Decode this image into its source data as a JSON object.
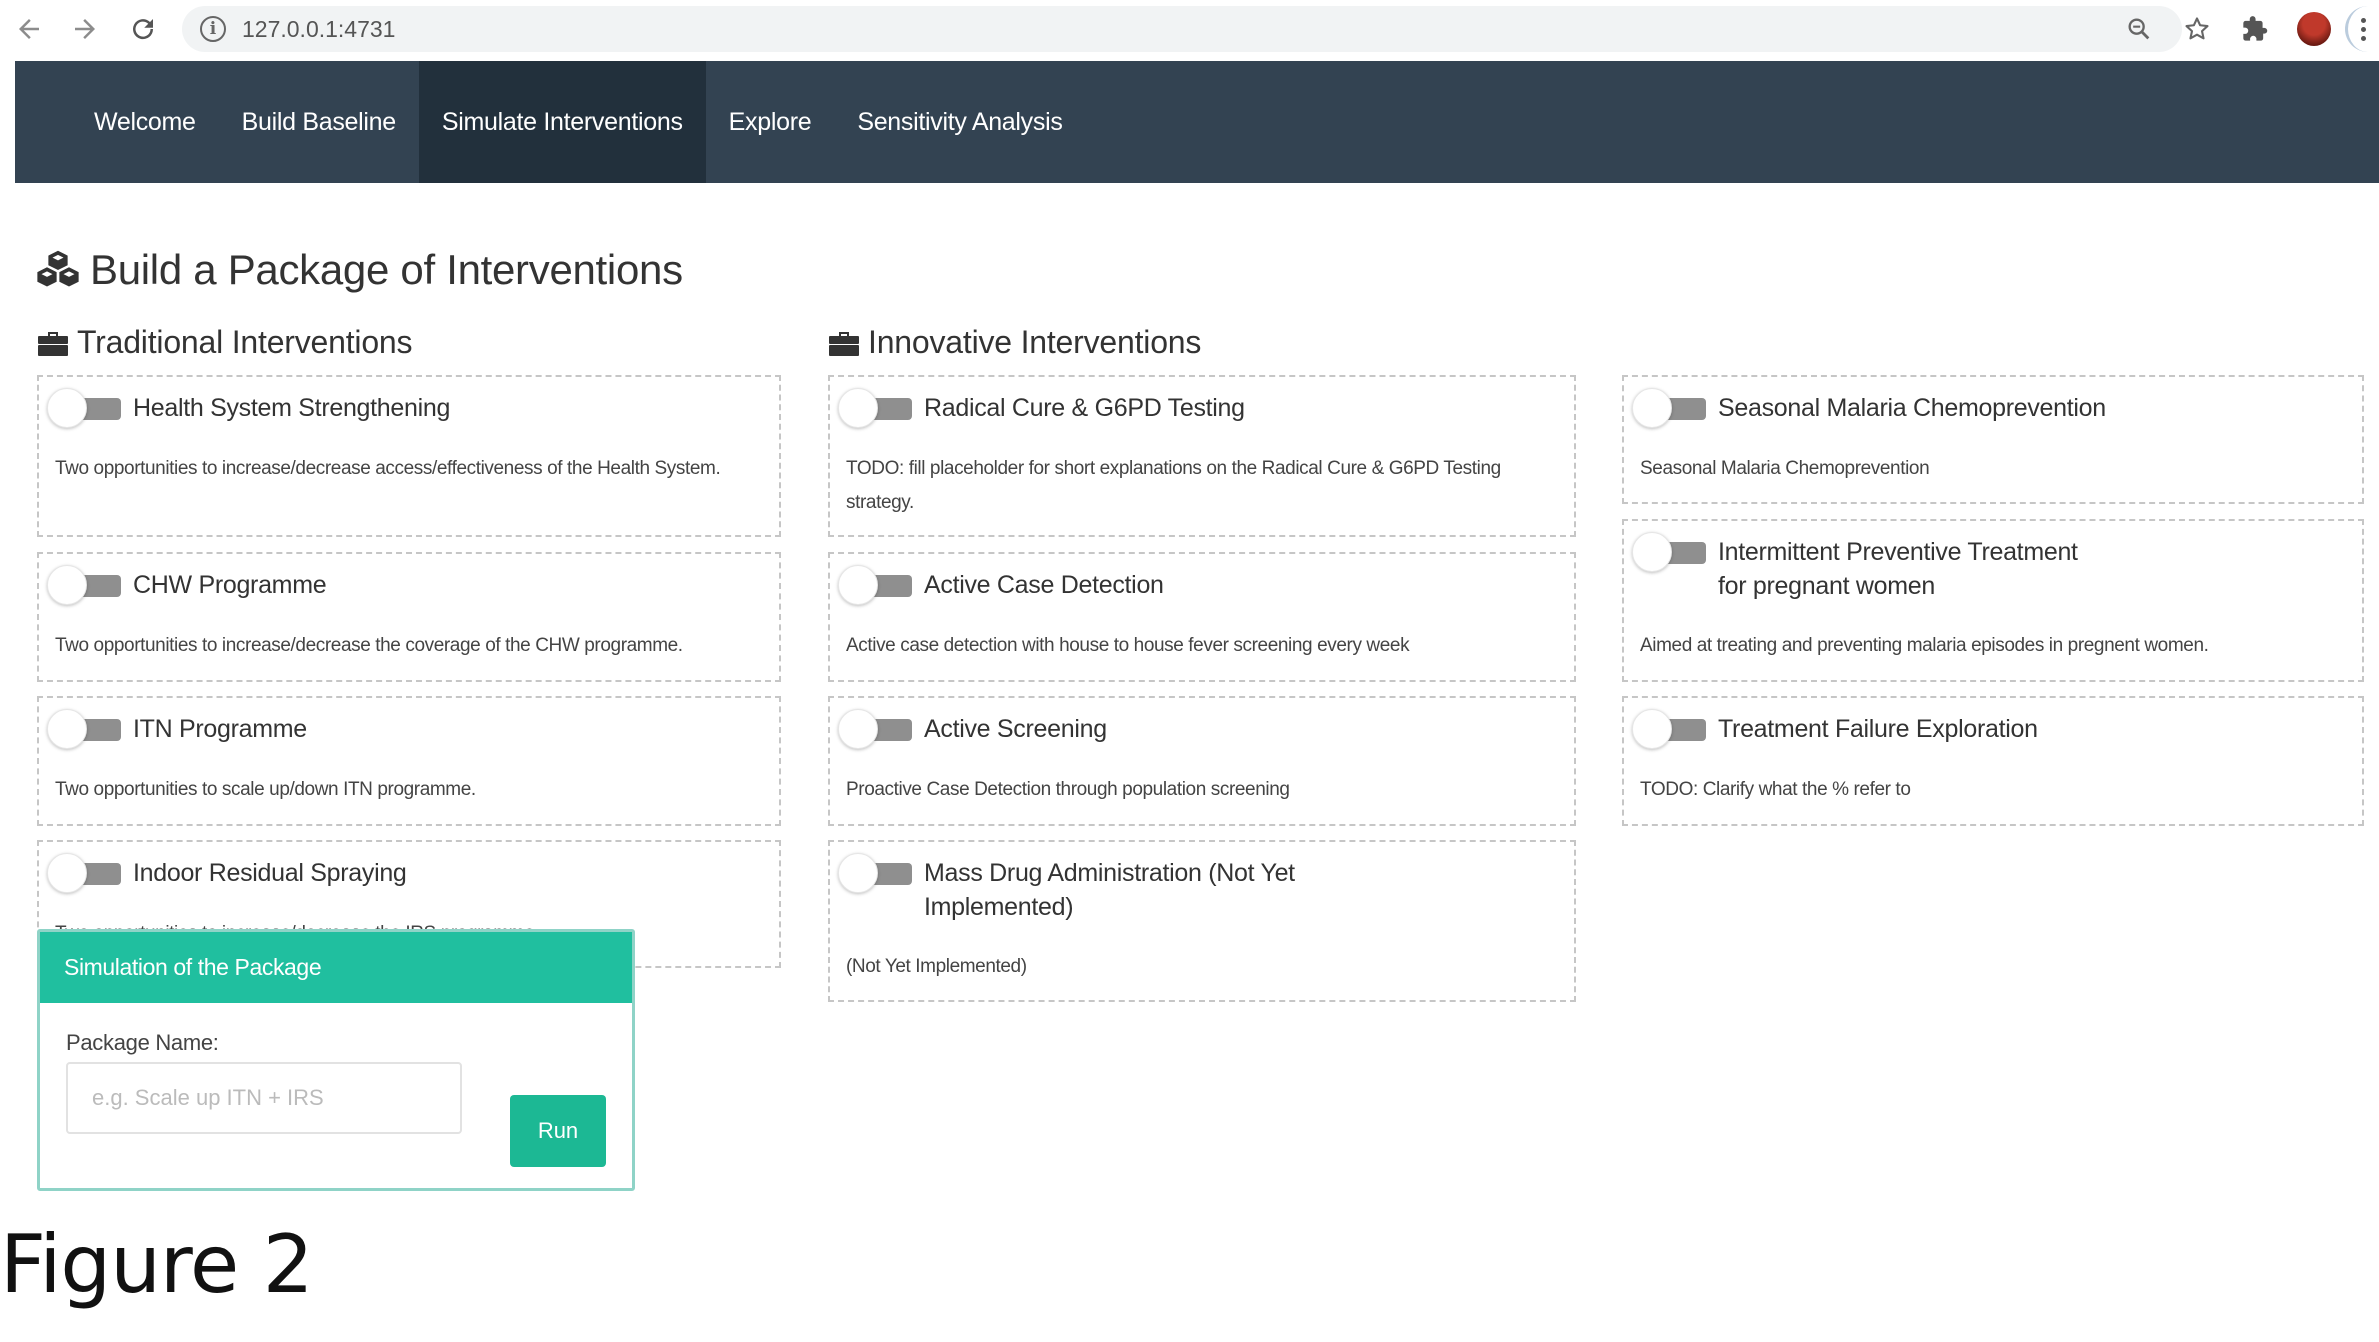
{
  "browser": {
    "url": "127.0.0.1:4731"
  },
  "navbar": {
    "items": [
      {
        "label": "Welcome",
        "active": false
      },
      {
        "label": "Build Baseline",
        "active": false
      },
      {
        "label": "Simulate Interventions",
        "active": true
      },
      {
        "label": "Explore",
        "active": false
      },
      {
        "label": "Sensitivity Analysis",
        "active": false
      }
    ]
  },
  "page": {
    "title": "Build a Package of Interventions"
  },
  "traditional": {
    "title": "Traditional Interventions",
    "cards": [
      {
        "name": "Health System Strengthening",
        "enabled": false,
        "description": "Two opportunities to increase/decrease access/effectiveness of the Health System."
      },
      {
        "name": "CHW Programme",
        "enabled": false,
        "description": "Two opportunities to increase/decrease the coverage of the CHW programme."
      },
      {
        "name": "ITN Programme",
        "enabled": false,
        "description": "Two opportunities to scale up/down ITN programme."
      },
      {
        "name": "Indoor Residual Spraying",
        "enabled": false,
        "description": "Two opportunities to increase/decrease the IRS programme."
      }
    ]
  },
  "innovative": {
    "title": "Innovative Interventions",
    "cards": [
      {
        "name": "Radical Cure & G6PD Testing",
        "enabled": false,
        "description": "TODO: fill placeholder for short explanations on the Radical Cure & G6PD Testing strategy."
      },
      {
        "name": "Active Case Detection",
        "enabled": false,
        "description": "Active case detection with house to house fever screening every week"
      },
      {
        "name": "Active Screening",
        "enabled": false,
        "description": "Proactive Case Detection through population screening"
      },
      {
        "name": "Mass Drug Administration (Not Yet Implemented)",
        "enabled": false,
        "description": "(Not Yet Implemented)"
      }
    ],
    "cards_right": [
      {
        "name": "Seasonal Malaria Chemoprevention",
        "enabled": false,
        "description": "Seasonal Malaria Chemoprevention"
      },
      {
        "name": "Intermittent Preventive Treatment for pregnant women",
        "enabled": false,
        "description": "Aimed at treating and preventing malaria episodes in pregnent women."
      },
      {
        "name": "Treatment Failure Exploration",
        "enabled": false,
        "description": "TODO: Clarify what the % refer to"
      }
    ]
  },
  "simulation": {
    "header": "Simulation of the Package",
    "label": "Package Name:",
    "input_value": "",
    "placeholder": "e.g. Scale up ITN + IRS",
    "run_label": "Run"
  },
  "caption": "Figure 2",
  "colors": {
    "navbar": "#334352",
    "navbar_active": "#22303c",
    "sim_header": "#20bf9f",
    "run_button": "#1cb894"
  }
}
